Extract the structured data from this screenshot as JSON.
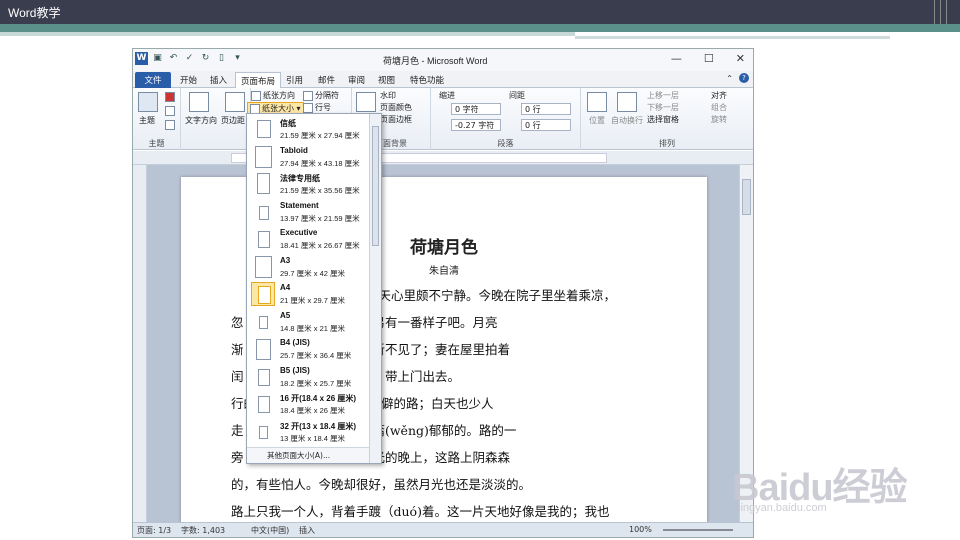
{
  "slide": {
    "title": "Word教学"
  },
  "window": {
    "title": "荷塘月色 - Microsoft Word",
    "min": "—",
    "max": "☐",
    "close": "✕"
  },
  "tabs": [
    "文件",
    "开始",
    "插入",
    "页面布局",
    "引用",
    "邮件",
    "审阅",
    "视图",
    "特色功能"
  ],
  "ribbon": {
    "theme": "主题",
    "text_dir": "文字方向",
    "margins": "页边距",
    "orientation": "纸张方向",
    "size": "纸张大小",
    "breaks": "分隔符",
    "line_numbers": "行号",
    "watermark": "水印",
    "page_color": "页面颜色",
    "page_border": "页面边框",
    "page_bg_label": "页面背景",
    "indent": "缩进",
    "spacing": "间距",
    "indent_left": "0 字符",
    "indent_right": "-0.27 字符",
    "spacing_before": "0 行",
    "spacing_after": "0 行",
    "paragraph_label": "段落",
    "position": "位置",
    "wrap": "自动换行",
    "forward": "上移一层",
    "backward": "下移一层",
    "selection_pane": "选择窗格",
    "align": "对齐",
    "group": "组合",
    "rotate": "旋转",
    "arrange_label": "排列",
    "theme_label": "主题"
  },
  "document": {
    "title": "荷塘月色",
    "author": "朱自清",
    "lines": [
      "向这几天心里颇不宁静。今晚在院子里坐着乘凉，",
      "忽                    在这满月的光里，总该另有一番样子吧。月亮",
      "渐                   上孩子们的欢笑，已经听不见了；妻在屋里拍着",
      "闰                   欢。我悄悄地披了大衫，带上门出去。",
      "                    行的小煤屑路。这是一条幽僻的路；白天也少人",
      "走                   四周，长着许多树，蓊蓊(wěng)郁郁的。路的一",
      "旁                   知道名字的树。没有月光的晚上，这路上阴森森",
      "的，有些怕人。今晚却很好，虽然月光也还是淡淡的。",
      "    路上只我一个人，背着手踱（duó)着。这一片天地好像是我的；我也"
    ]
  },
  "dropdown": {
    "items": [
      {
        "name": "信纸",
        "size": "21.59 厘米 x 27.94 厘米"
      },
      {
        "name": "Tabloid",
        "size": "27.94 厘米 x 43.18 厘米"
      },
      {
        "name": "法律专用纸",
        "size": "21.59 厘米 x 35.56 厘米"
      },
      {
        "name": "Statement",
        "size": "13.97 厘米 x 21.59 厘米"
      },
      {
        "name": "Executive",
        "size": "18.41 厘米 x 26.67 厘米"
      },
      {
        "name": "A3",
        "size": "29.7 厘米 x 42 厘米"
      },
      {
        "name": "A4",
        "size": "21 厘米 x 29.7 厘米"
      },
      {
        "name": "A5",
        "size": "14.8 厘米 x 21 厘米"
      },
      {
        "name": "B4 (JIS)",
        "size": "25.7 厘米 x 36.4 厘米"
      },
      {
        "name": "B5 (JIS)",
        "size": "18.2 厘米 x 25.7 厘米"
      },
      {
        "name": "16 开(18.4 x 26 厘米)",
        "size": "18.4 厘米 x 26 厘米"
      },
      {
        "name": "32 开(13 x 18.4 厘米)",
        "size": "13 厘米 x 18.4 厘米"
      }
    ],
    "more": "其他页面大小(A)..."
  },
  "status": {
    "page": "页面: 1/3",
    "words": "字数: 1,403",
    "lang": "中文(中国)",
    "mode": "插入",
    "zoom": "100%"
  },
  "watermark": {
    "brand": "Baidu经验",
    "url": "jingyan.baidu.com"
  }
}
